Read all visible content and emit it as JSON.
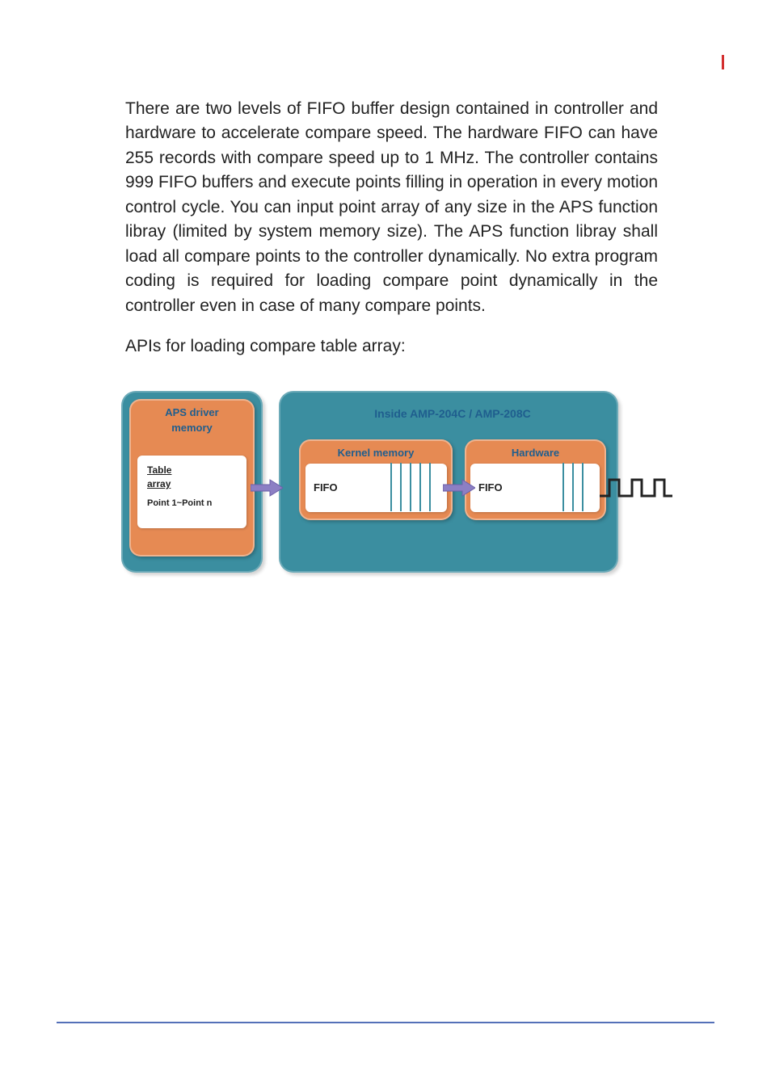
{
  "body_paragraph": "There are two levels of FIFO buffer design contained in controller and hardware to accelerate compare speed. The hardware FIFO can have 255 records with compare speed up to 1 MHz. The controller contains 999 FIFO buffers and execute points filling in operation in every motion control cycle. You can input point array of any size in the APS function libray (limited by system memory size). The APS function libray shall load all compare points to the controller dynamically. No extra program coding is required for loading compare point dynamically in the controller even in case of many compare points.",
  "api_line": "APIs for loading compare table array:",
  "diagram": {
    "left_block": {
      "title_line1": "APS driver",
      "title_line2": "memory",
      "table_label": "Table",
      "array_label": "array",
      "point_label": "Point 1~Point n"
    },
    "right_block": {
      "inside_title": "Inside AMP-204C / AMP-208C",
      "kernel": {
        "title": "Kernel memory",
        "fifo_label": "FIFO",
        "slot_count": 5
      },
      "hardware": {
        "title": "Hardware",
        "fifo_label": "FIFO",
        "slot_count": 3
      }
    }
  },
  "colors": {
    "teal": "#3b8ea0",
    "orange": "#e68a53",
    "arrow": "#8c7fc4",
    "title_text": "#1f5e8e"
  },
  "chart_data": {
    "type": "diagram",
    "description": "Block diagram showing data flow from APS driver memory (Table array, Point 1~Point n) via arrow into AMP-204C / AMP-208C controller, first into Kernel memory FIFO (999 buffers), then via arrow into Hardware FIFO (255 records, up to 1 MHz), then out as pulse signal.",
    "flow": [
      "APS driver memory / Table array",
      "Kernel memory FIFO",
      "Hardware FIFO",
      "Output pulse"
    ],
    "capacities": {
      "hardware_fifo_records": 255,
      "controller_fifo_buffers": 999,
      "hardware_compare_speed_mhz": 1
    }
  }
}
